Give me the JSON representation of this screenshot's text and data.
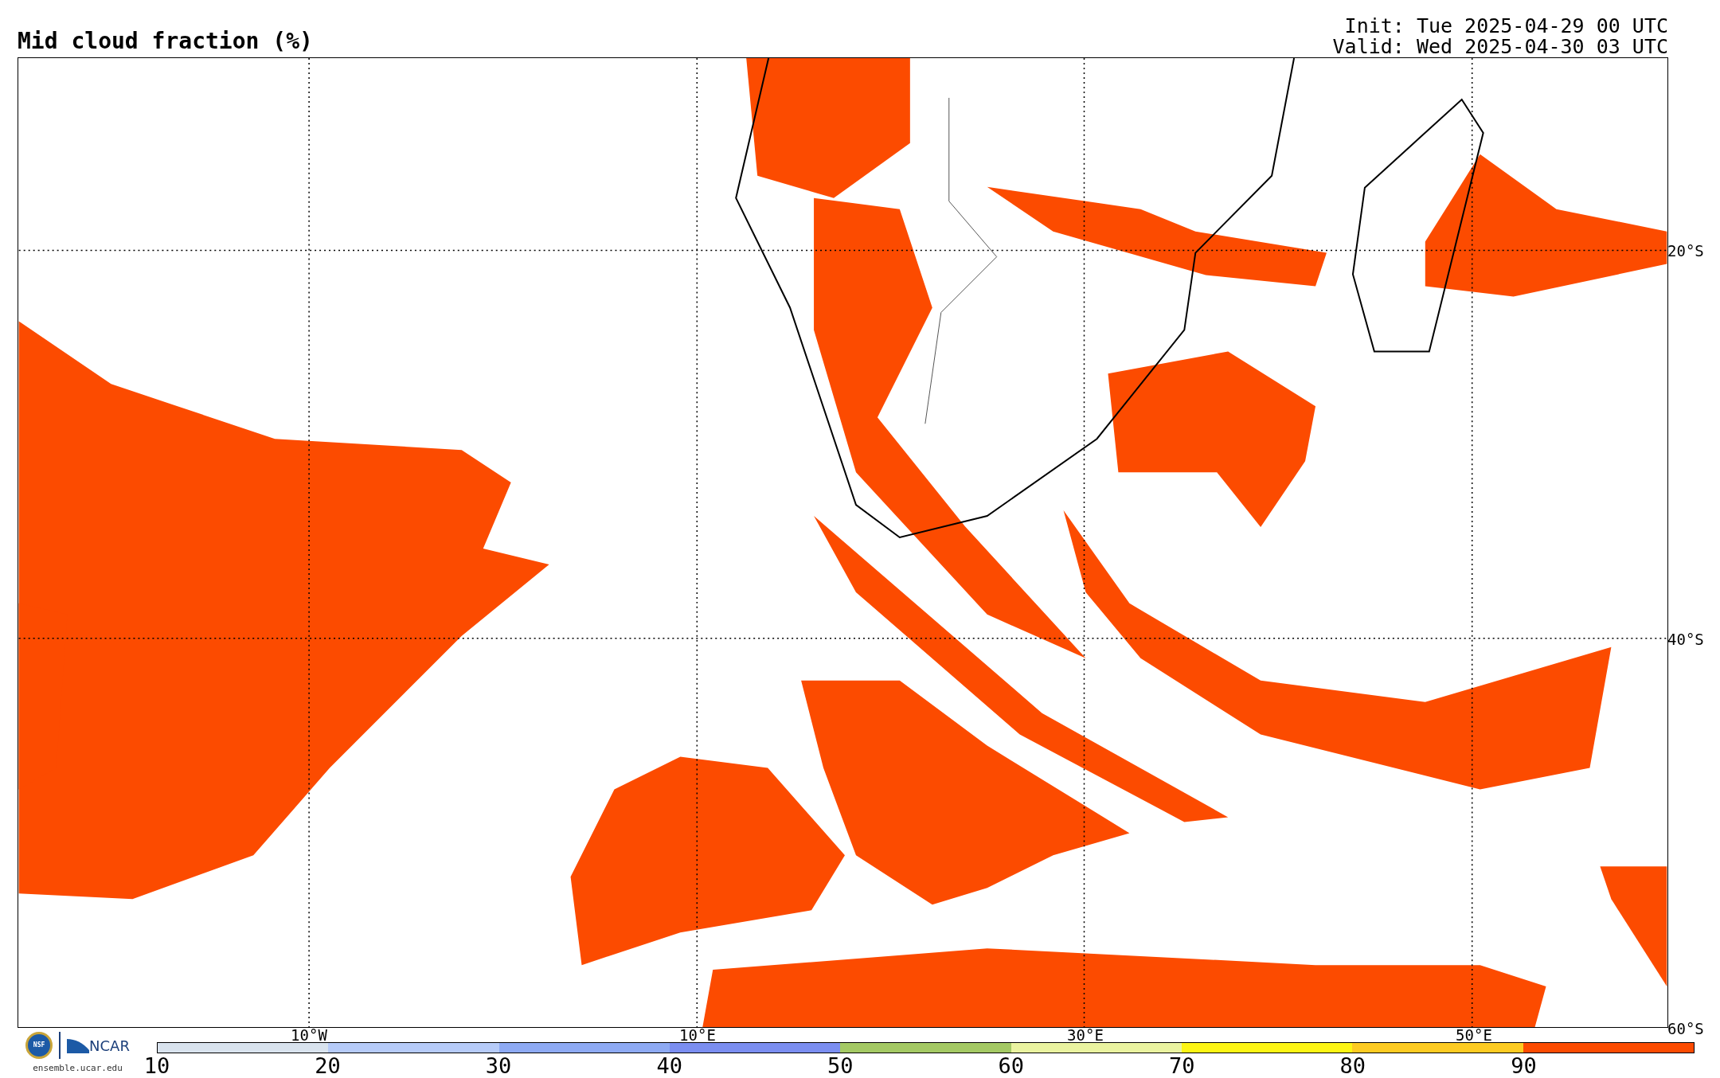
{
  "title": "Mid cloud fraction (%)",
  "init": "Init: Tue 2025-04-29 00 UTC",
  "valid": "Valid: Wed 2025-04-30 03 UTC",
  "map": {
    "lat_labels": [
      "20°S",
      "40°S",
      "60°S"
    ],
    "lon_labels": [
      "10°W",
      "10°E",
      "30°E",
      "50°E"
    ]
  },
  "colorbar": {
    "segments": [
      {
        "color": "#d9e3ee"
      },
      {
        "color": "#b6cbf8"
      },
      {
        "color": "#8eaaf3"
      },
      {
        "color": "#7b8ef0"
      },
      {
        "color": "#a4c964"
      },
      {
        "color": "#eaf3a0"
      },
      {
        "color": "#fdf514"
      },
      {
        "color": "#fdcb22"
      },
      {
        "color": "#fc4b00"
      }
    ],
    "labels": [
      "10",
      "20",
      "30",
      "40",
      "50",
      "60",
      "70",
      "80",
      "90"
    ]
  },
  "logos": {
    "nsf": "NSF",
    "ncar": "NCAR",
    "url": "ensemble.ucar.edu"
  }
}
